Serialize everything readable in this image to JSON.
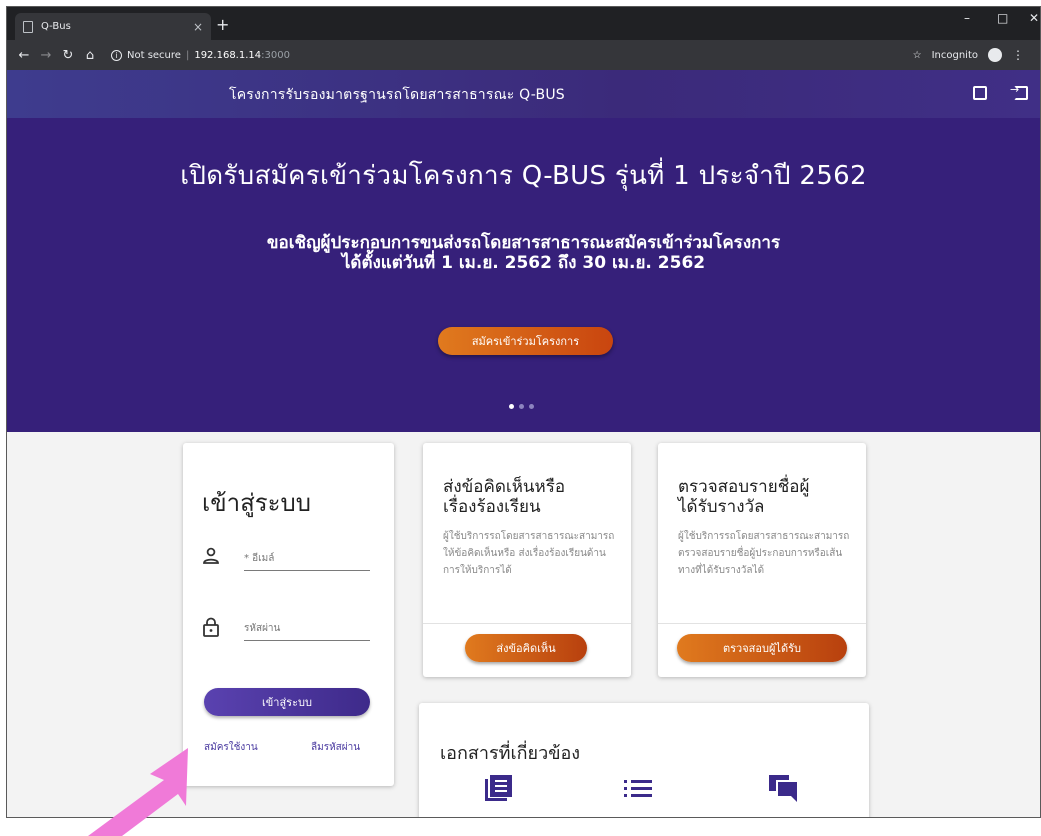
{
  "browser": {
    "tab_title": "Q-Bus",
    "tab_close": "×",
    "new_tab": "+",
    "window_minimize": "–",
    "window_maximize": "□",
    "window_close": "✕",
    "security_label": "Not secure",
    "url_host": "192.168.1.14",
    "url_port": ":3000",
    "incognito_label": "Incognito"
  },
  "header": {
    "title": "โครงการรับรองมาตรฐานรถโดยสารสาธารณะ Q-BUS"
  },
  "hero": {
    "heading": "เปิดรับสมัครเข้าร่วมโครงการ Q-BUS รุ่นที่ 1 ประจำปี 2562",
    "sub_line1": "ขอเชิญผู้ประกอบการขนส่งรถโดยสารสาธารณะสมัครเข้าร่วมโครงการ",
    "sub_line2": "ได้ตั้งแต่วันที่ 1 เม.ย. 2562 ถึง 30 เม.ย. 2562",
    "cta_label": "สมัครเข้าร่วมโครงการ",
    "slide_count": 3,
    "active_slide": 1
  },
  "login": {
    "title": "เข้าสู่ระบบ",
    "email_placeholder": "* อีเมล์",
    "password_placeholder": "รหัสผ่าน",
    "submit_label": "เข้าสู่ระบบ",
    "register_link": "สมัครใช้งาน",
    "forgot_link": "ลืมรหัสผ่าน"
  },
  "complaint_card": {
    "title_line1": "ส่งข้อคิดเห็นหรือ",
    "title_line2": "เรื่องร้องเรียน",
    "desc": "ผู้ใช้บริการรถโดยสารสาธารณะสามารถให้ข้อคิดเห็นหรือ ส่งเรื่องร้องเรียนด้านการให้บริการได้",
    "button_label": "ส่งข้อคิดเห็น"
  },
  "check_card": {
    "title_line1": "ตรวจสอบรายชื่อผู้",
    "title_line2": "ได้รับรางวัล",
    "desc": "ผู้ใช้บริการรถโดยสารสาธารณะสามารถตรวจสอบรายชื่อผู้ประกอบการหรือเส้นทางที่ได้รับรางวัลได้",
    "button_label": "ตรวจสอบผู้ได้รับ"
  },
  "docs_card": {
    "title": "เอกสารที่เกี่ยวข้อง"
  },
  "colors": {
    "brand_purple": "#36207a",
    "accent_orange": "#e07a1e",
    "annotation_pink": "#f07ad8"
  }
}
